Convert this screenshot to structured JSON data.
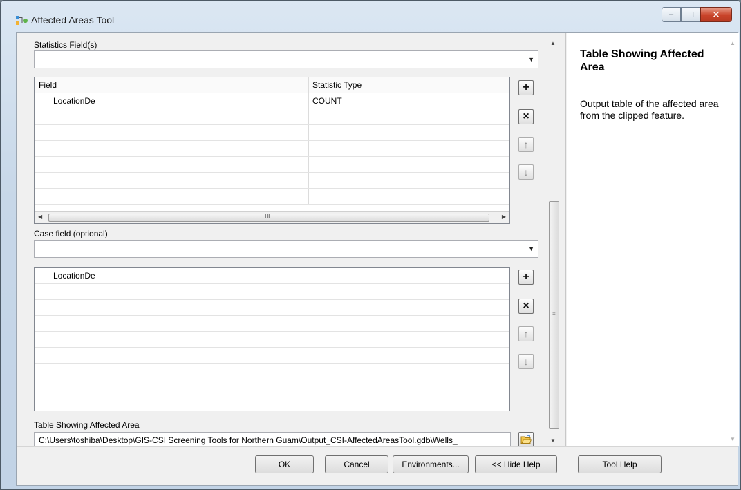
{
  "window": {
    "title": "Affected Areas Tool",
    "controls": {
      "minimize": "–",
      "maximize": "☐",
      "close": "✕"
    }
  },
  "stats_section": {
    "label": "Statistics Field(s)",
    "dropdown_value": "",
    "columns": [
      "Field",
      "Statistic Type"
    ],
    "rows": [
      {
        "field": "LocationDe",
        "stat": "COUNT"
      }
    ],
    "buttons": {
      "add": "+",
      "remove": "×",
      "up": "↑",
      "down": "↓"
    },
    "scroll_grip": "III"
  },
  "case_section": {
    "label": "Case field (optional)",
    "dropdown_value": "",
    "items": [
      "LocationDe"
    ],
    "buttons": {
      "add": "+",
      "remove": "×",
      "up": "↑",
      "down": "↓"
    }
  },
  "output_section": {
    "label": "Table Showing Affected Area",
    "value": "C:\\Users\\toshiba\\Desktop\\GIS-CSI Screening Tools for Northern Guam\\Output_CSI-AffectedAreasTool.gdb\\Wells_"
  },
  "help": {
    "title": "Table Showing Affected Area",
    "description": "Output table of the affected area from the clipped feature."
  },
  "footer": {
    "ok": "OK",
    "cancel": "Cancel",
    "environments": "Environments...",
    "hide_help": "<< Hide Help",
    "tool_help": "Tool Help"
  },
  "icons": {
    "app": "model-tool-icon",
    "browse": "open-folder-icon",
    "dropdown": "chevron-down-icon"
  }
}
